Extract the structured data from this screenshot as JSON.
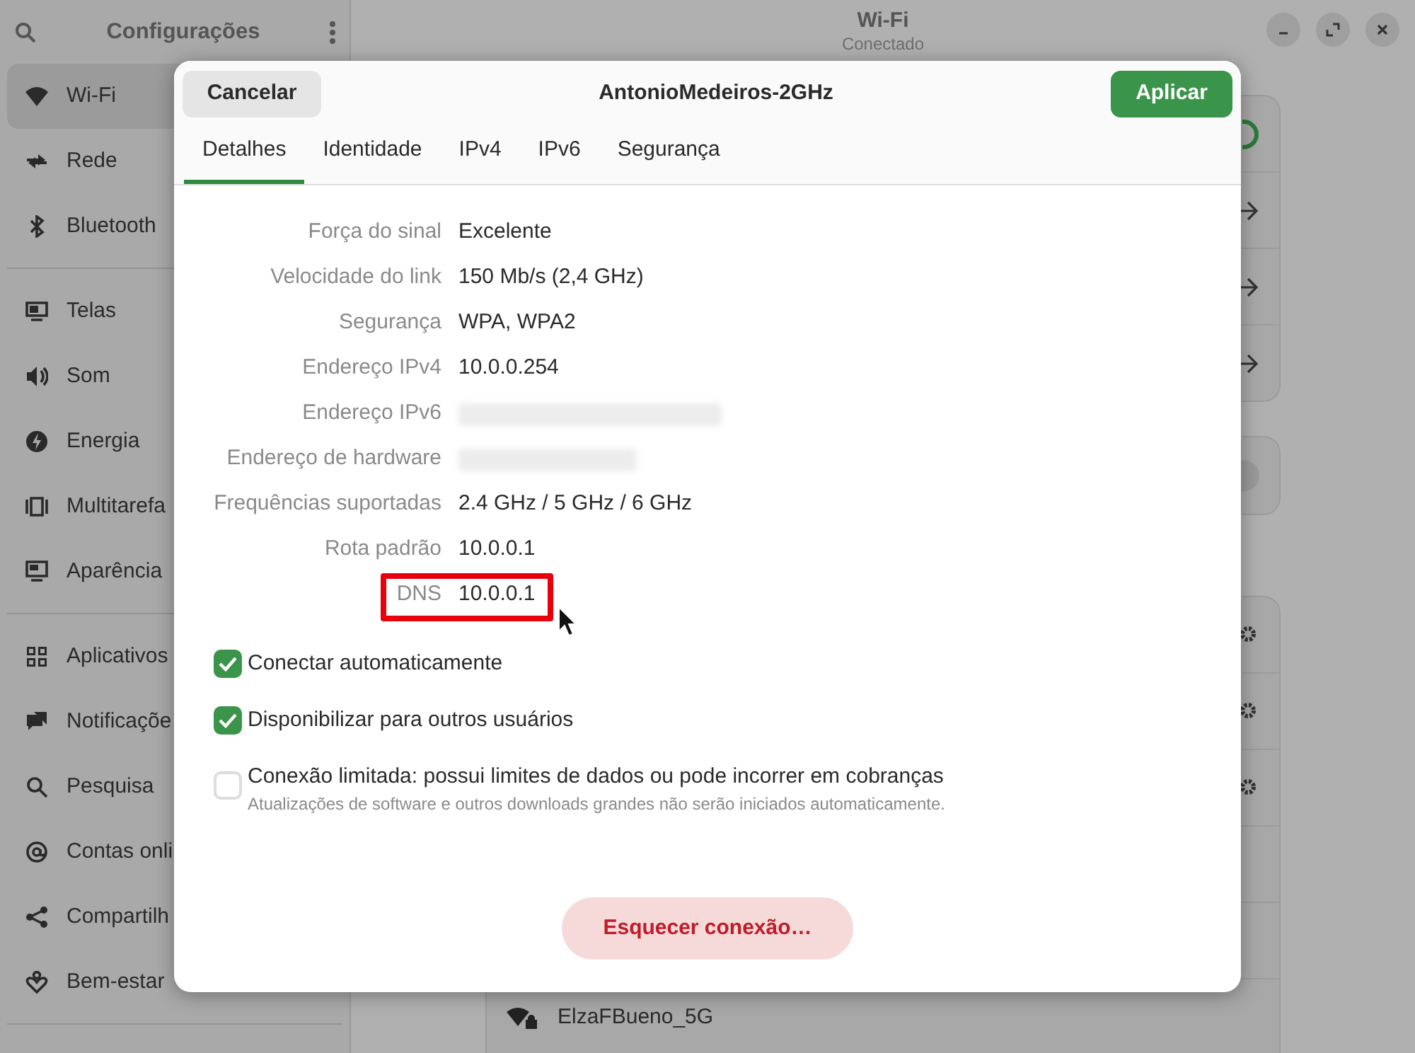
{
  "sidebar": {
    "title": "Configurações",
    "sections": [
      {
        "items": [
          {
            "label": "Wi-Fi",
            "selected": true
          },
          {
            "label": "Rede",
            "selected": false
          },
          {
            "label": "Bluetooth",
            "selected": false
          }
        ]
      },
      {
        "items": [
          {
            "label": "Telas",
            "selected": false
          },
          {
            "label": "Som",
            "selected": false
          },
          {
            "label": "Energia",
            "selected": false
          },
          {
            "label": "Multitarefa",
            "selected": false
          },
          {
            "label": "Aparência",
            "selected": false
          }
        ]
      },
      {
        "items": [
          {
            "label": "Aplicativos",
            "selected": false
          },
          {
            "label": "Notificaçõe",
            "selected": false
          },
          {
            "label": "Pesquisa",
            "selected": false
          },
          {
            "label": "Contas onli",
            "selected": false
          },
          {
            "label": "Compartilh",
            "selected": false
          },
          {
            "label": "Bem-estar",
            "selected": false
          }
        ]
      }
    ]
  },
  "main": {
    "title": "Wi-Fi",
    "subtitle": "Conectado",
    "networks": [
      {
        "name": "ElzaFBueno_5G"
      }
    ]
  },
  "dialog": {
    "title": "AntonioMedeiros-2GHz",
    "cancel": "Cancelar",
    "apply": "Aplicar",
    "tabs": [
      {
        "label": "Detalhes",
        "selected": true
      },
      {
        "label": "Identidade",
        "selected": false
      },
      {
        "label": "IPv4",
        "selected": false
      },
      {
        "label": "IPv6",
        "selected": false
      },
      {
        "label": "Segurança",
        "selected": false
      }
    ],
    "details": [
      {
        "label": "Força do sinal",
        "value": "Excelente",
        "highlighted": false
      },
      {
        "label": "Velocidade do link",
        "value": "150 Mb/s (2,4 GHz)",
        "highlighted": false
      },
      {
        "label": "Segurança",
        "value": "WPA, WPA2",
        "highlighted": false
      },
      {
        "label": "Endereço IPv4",
        "value": "10.0.0.254",
        "highlighted": false
      },
      {
        "label": "Endereço IPv6",
        "blurred": true,
        "highlighted": false
      },
      {
        "label": "Endereço de hardware",
        "blurred": true,
        "highlighted": false
      },
      {
        "label": "Frequências suportadas",
        "value": "2.4 GHz / 5 GHz / 6 GHz",
        "highlighted": false
      },
      {
        "label": "Rota padrão",
        "value": "10.0.0.1",
        "highlighted": false
      },
      {
        "label": "DNS",
        "value": "10.0.0.1",
        "highlighted": true
      }
    ],
    "options": [
      {
        "label": "Conectar automaticamente",
        "checked": true
      },
      {
        "label": "Disponibilizar para outros usuários",
        "checked": true
      },
      {
        "label": "Conexão limitada: possui limites de dados ou pode incorrer em cobranças",
        "description": "Atualizações de software e outros downloads grandes não serão iniciados automaticamente.",
        "checked": false
      }
    ],
    "forget": "Esquecer conexão…"
  }
}
